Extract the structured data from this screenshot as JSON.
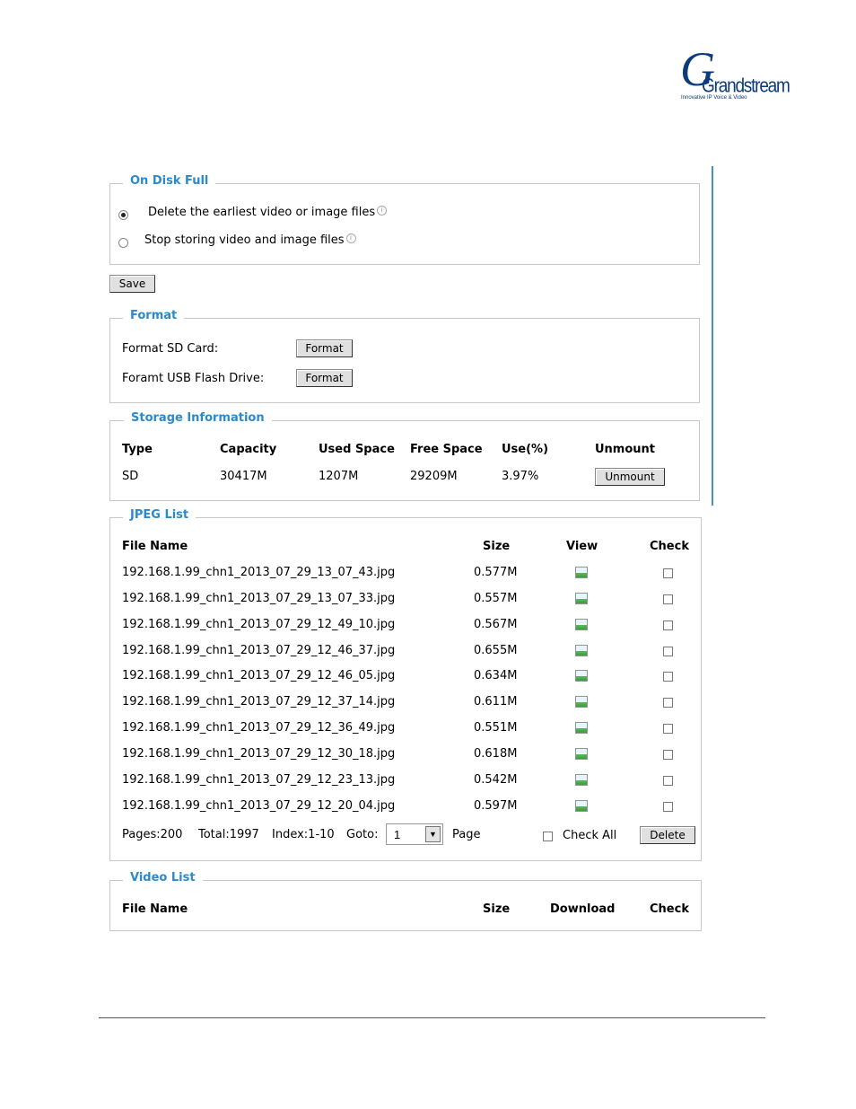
{
  "logo": {
    "brand_text": "Grandstream",
    "tagline": "Innovative IP Voice & Video"
  },
  "disk_full": {
    "legend": "On Disk Full",
    "options": [
      {
        "label": "Delete the earliest video or image files",
        "selected": true
      },
      {
        "label": "Stop storing video and image files",
        "selected": false
      }
    ],
    "save_label": "Save"
  },
  "format": {
    "legend": "Format",
    "rows": [
      {
        "label": "Format SD Card:",
        "button": "Format"
      },
      {
        "label": "Foramt USB Flash Drive:",
        "button": "Format"
      }
    ]
  },
  "storage": {
    "legend": "Storage Information",
    "headers": [
      "Type",
      "Capacity",
      "Used Space",
      "Free Space",
      "Use(%)",
      "Unmount"
    ],
    "row": {
      "type": "SD",
      "capacity": "30417M",
      "used": "1207M",
      "free": "29209M",
      "use_pct": "3.97%",
      "unmount_label": "Unmount"
    }
  },
  "jpeg": {
    "legend": "JPEG List",
    "headers": {
      "file": "File Name",
      "size": "Size",
      "view": "View",
      "check": "Check"
    },
    "files": [
      {
        "name": "192.168.1.99_chn1_2013_07_29_13_07_43.jpg",
        "size": "0.577M"
      },
      {
        "name": "192.168.1.99_chn1_2013_07_29_13_07_33.jpg",
        "size": "0.557M"
      },
      {
        "name": "192.168.1.99_chn1_2013_07_29_12_49_10.jpg",
        "size": "0.567M"
      },
      {
        "name": "192.168.1.99_chn1_2013_07_29_12_46_37.jpg",
        "size": "0.655M"
      },
      {
        "name": "192.168.1.99_chn1_2013_07_29_12_46_05.jpg",
        "size": "0.634M"
      },
      {
        "name": "192.168.1.99_chn1_2013_07_29_12_37_14.jpg",
        "size": "0.611M"
      },
      {
        "name": "192.168.1.99_chn1_2013_07_29_12_36_49.jpg",
        "size": "0.551M"
      },
      {
        "name": "192.168.1.99_chn1_2013_07_29_12_30_18.jpg",
        "size": "0.618M"
      },
      {
        "name": "192.168.1.99_chn1_2013_07_29_12_23_13.jpg",
        "size": "0.542M"
      },
      {
        "name": "192.168.1.99_chn1_2013_07_29_12_20_04.jpg",
        "size": "0.597M"
      }
    ],
    "pager": {
      "pages": "Pages:200",
      "total": "Total:1997",
      "index": "Index:1-10",
      "goto_label": "Goto:",
      "goto_value": "1",
      "page_label": "Page",
      "check_all_label": "Check All",
      "delete_label": "Delete"
    }
  },
  "video": {
    "legend": "Video List",
    "headers": {
      "file": "File Name",
      "size": "Size",
      "download": "Download",
      "check": "Check"
    }
  }
}
